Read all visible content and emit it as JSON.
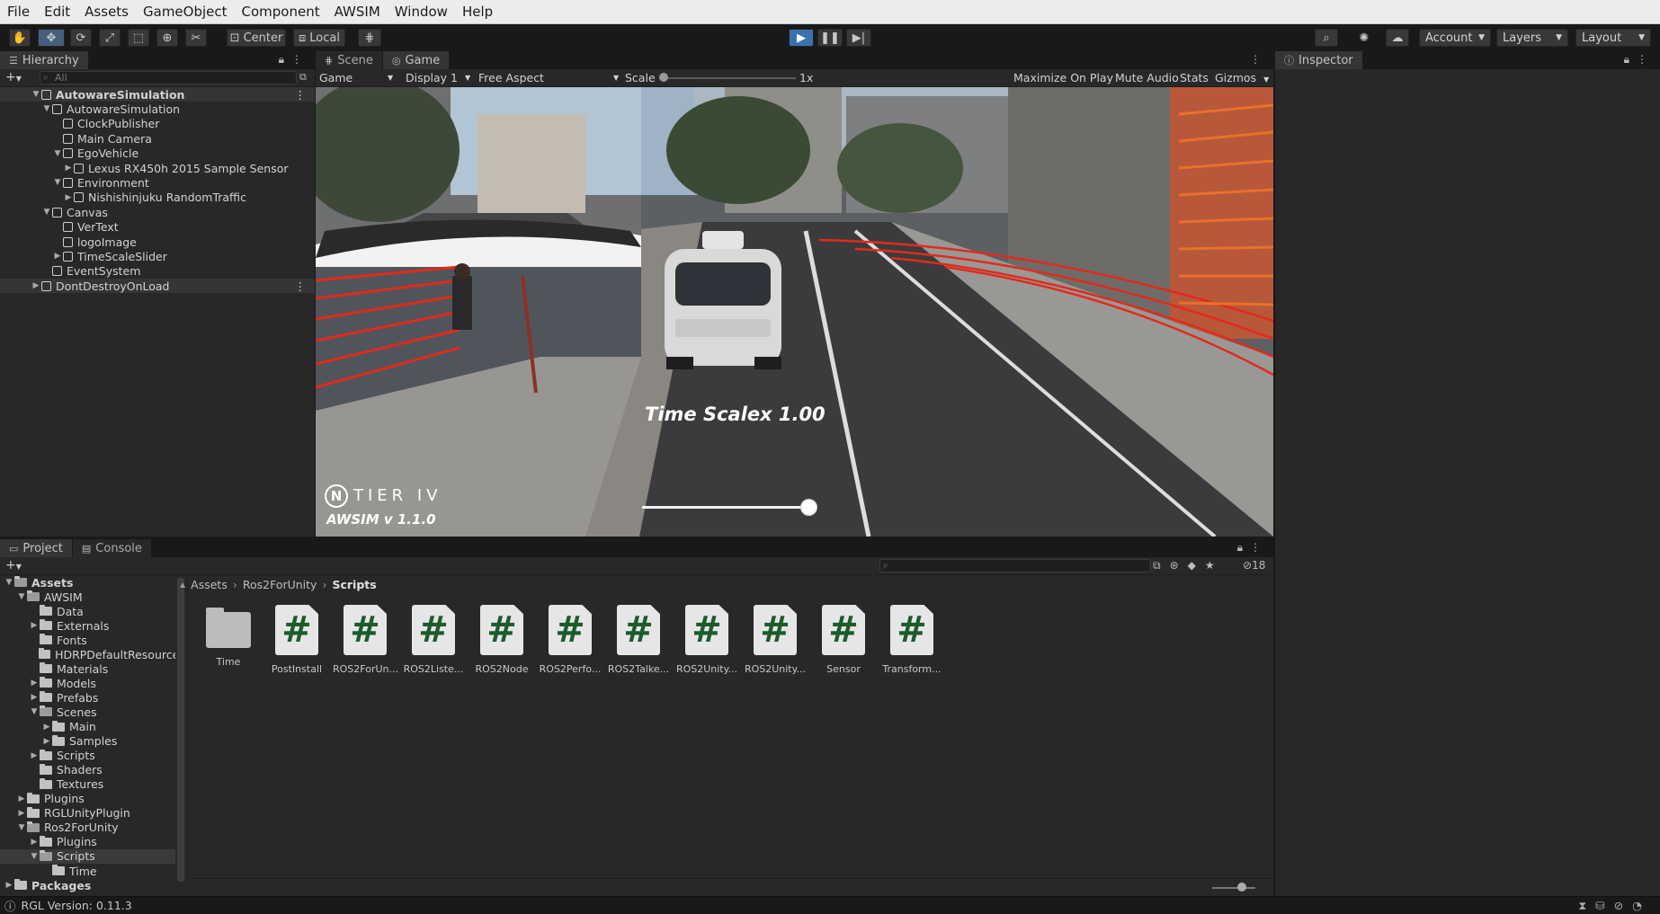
{
  "menu": [
    "File",
    "Edit",
    "Assets",
    "GameObject",
    "Component",
    "AWSIM",
    "Window",
    "Help"
  ],
  "toolbar": {
    "pivot": "Center",
    "space": "Local",
    "account": "Account",
    "layers": "Layers",
    "layout": "Layout"
  },
  "hierarchy": {
    "tab": "Hierarchy",
    "search_placeholder": "All",
    "rows": [
      {
        "label": "AutowareSimulation",
        "depth": 0,
        "kind": "scene",
        "arrow": "▼"
      },
      {
        "label": "AutowareSimulation",
        "depth": 1,
        "kind": "obj",
        "arrow": "▼"
      },
      {
        "label": "ClockPublisher",
        "depth": 2,
        "kind": "obj",
        "arrow": ""
      },
      {
        "label": "Main Camera",
        "depth": 2,
        "kind": "obj",
        "arrow": ""
      },
      {
        "label": "EgoVehicle",
        "depth": 2,
        "kind": "obj",
        "arrow": "▼"
      },
      {
        "label": "Lexus RX450h 2015 Sample Sensor",
        "depth": 3,
        "kind": "obj",
        "arrow": "▶"
      },
      {
        "label": "Environment",
        "depth": 2,
        "kind": "obj",
        "arrow": "▼"
      },
      {
        "label": "Nishishinjuku RandomTraffic",
        "depth": 3,
        "kind": "obj",
        "arrow": "▶"
      },
      {
        "label": "Canvas",
        "depth": 1,
        "kind": "obj",
        "arrow": "▼"
      },
      {
        "label": "VerText",
        "depth": 2,
        "kind": "obj",
        "arrow": ""
      },
      {
        "label": "logoImage",
        "depth": 2,
        "kind": "obj",
        "arrow": ""
      },
      {
        "label": "TimeScaleSlider",
        "depth": 2,
        "kind": "obj",
        "arrow": "▶"
      },
      {
        "label": "EventSystem",
        "depth": 1,
        "kind": "obj",
        "arrow": ""
      },
      {
        "label": "DontDestroyOnLoad",
        "depth": 0,
        "kind": "scene",
        "arrow": "▶"
      }
    ]
  },
  "game": {
    "tab_scene": "Scene",
    "tab_game": "Game",
    "mode": "Game",
    "display": "Display 1",
    "aspect": "Free Aspect",
    "scale_label": "Scale",
    "scale_value": "1x",
    "maximize": "Maximize On Play",
    "mute": "Mute Audio",
    "stats": "Stats",
    "gizmos": "Gizmos",
    "overlay_timescale": "Time Scale",
    "overlay_multiplier": "x 1.00",
    "logo_text": "TIER IV",
    "version_text": "AWSIM  v 1.1.0",
    "time_scale_slider": 1.0
  },
  "inspector": {
    "tab": "Inspector"
  },
  "project": {
    "tab_project": "Project",
    "tab_console": "Console",
    "breadcrumb": [
      "Assets",
      "Ros2ForUnity",
      "Scripts"
    ],
    "hidden_count": "18",
    "tree": [
      {
        "label": "Assets",
        "depth": 0,
        "arrow": "▼",
        "open": true,
        "bold": true
      },
      {
        "label": "AWSIM",
        "depth": 1,
        "arrow": "▼",
        "open": true
      },
      {
        "label": "Data",
        "depth": 2,
        "arrow": "",
        "open": false
      },
      {
        "label": "Externals",
        "depth": 2,
        "arrow": "▶",
        "open": false
      },
      {
        "label": "Fonts",
        "depth": 2,
        "arrow": "",
        "open": false
      },
      {
        "label": "HDRPDefaultResources",
        "depth": 2,
        "arrow": "",
        "open": false
      },
      {
        "label": "Materials",
        "depth": 2,
        "arrow": "",
        "open": false
      },
      {
        "label": "Models",
        "depth": 2,
        "arrow": "▶",
        "open": false
      },
      {
        "label": "Prefabs",
        "depth": 2,
        "arrow": "▶",
        "open": false
      },
      {
        "label": "Scenes",
        "depth": 2,
        "arrow": "▼",
        "open": true
      },
      {
        "label": "Main",
        "depth": 3,
        "arrow": "▶",
        "open": false
      },
      {
        "label": "Samples",
        "depth": 3,
        "arrow": "▶",
        "open": false
      },
      {
        "label": "Scripts",
        "depth": 2,
        "arrow": "▶",
        "open": false
      },
      {
        "label": "Shaders",
        "depth": 2,
        "arrow": "",
        "open": false
      },
      {
        "label": "Textures",
        "depth": 2,
        "arrow": "",
        "open": false
      },
      {
        "label": "Plugins",
        "depth": 1,
        "arrow": "▶",
        "open": false
      },
      {
        "label": "RGLUnityPlugin",
        "depth": 1,
        "arrow": "▶",
        "open": false
      },
      {
        "label": "Ros2ForUnity",
        "depth": 1,
        "arrow": "▼",
        "open": true
      },
      {
        "label": "Plugins",
        "depth": 2,
        "arrow": "▶",
        "open": false
      },
      {
        "label": "Scripts",
        "depth": 2,
        "arrow": "▼",
        "open": true,
        "selected": true
      },
      {
        "label": "Time",
        "depth": 3,
        "arrow": "",
        "open": false
      },
      {
        "label": "Packages",
        "depth": 0,
        "arrow": "▶",
        "open": false,
        "bold": true
      }
    ],
    "assets": [
      {
        "label": "Time",
        "kind": "folder"
      },
      {
        "label": "PostInstall",
        "kind": "script"
      },
      {
        "label": "ROS2ForUn...",
        "kind": "script"
      },
      {
        "label": "ROS2Liste...",
        "kind": "script"
      },
      {
        "label": "ROS2Node",
        "kind": "script"
      },
      {
        "label": "ROS2Perfo...",
        "kind": "script"
      },
      {
        "label": "ROS2Talke...",
        "kind": "script"
      },
      {
        "label": "ROS2Unity...",
        "kind": "script"
      },
      {
        "label": "ROS2Unity...",
        "kind": "script"
      },
      {
        "label": "Sensor",
        "kind": "script"
      },
      {
        "label": "Transform...",
        "kind": "script"
      }
    ]
  },
  "status": {
    "text": "RGL Version: 0.11.3"
  }
}
